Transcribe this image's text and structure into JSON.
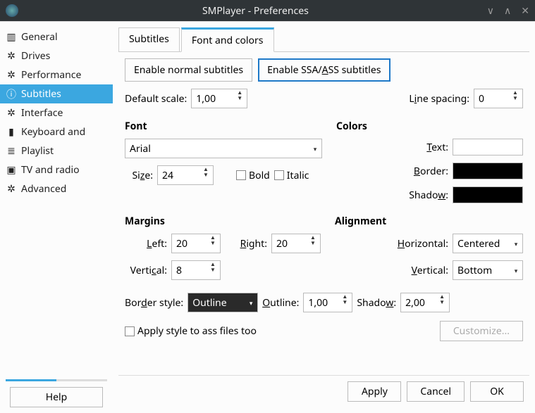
{
  "window": {
    "title": "SMPlayer - Preferences"
  },
  "sidebar": {
    "items": [
      {
        "label": "General",
        "icon": "sliders-icon"
      },
      {
        "label": "Drives",
        "icon": "gear-icon"
      },
      {
        "label": "Performance",
        "icon": "gear-icon"
      },
      {
        "label": "Subtitles",
        "icon": "info-icon"
      },
      {
        "label": "Interface",
        "icon": "gear-icon"
      },
      {
        "label": "Keyboard and",
        "icon": "keyboard-icon"
      },
      {
        "label": "Playlist",
        "icon": "list-icon"
      },
      {
        "label": "TV and radio",
        "icon": "tv-icon"
      },
      {
        "label": "Advanced",
        "icon": "gear-icon"
      }
    ]
  },
  "tabs": {
    "subtitles": "Subtitles",
    "fontcolors": "Font and colors"
  },
  "subtabs": {
    "normal": "Enable normal subtitles",
    "ssa_pre": "Enable SSA/",
    "ssa_u": "A",
    "ssa_post": "SS subtitles"
  },
  "labels": {
    "default_scale": "Default scale:",
    "line_spacing_pre": "L",
    "line_spacing_u": "i",
    "line_spacing_post": "ne spacing:",
    "font_group": "Font",
    "colors_group": "Colors",
    "size_pre": "Si",
    "size_u": "z",
    "size_post": "e:",
    "bold": "Bold",
    "italic": "Italic",
    "text_pre": "",
    "text_u": "T",
    "text_post": "ext:",
    "border_pre": "",
    "border_u": "B",
    "border_post": "order:",
    "shadow_pre": "Shado",
    "shadow_u": "w",
    "shadow_post": ":",
    "margins_group": "Margins",
    "alignment_group": "Alignment",
    "left_pre": "",
    "left_u": "L",
    "left_post": "eft:",
    "right_pre": "",
    "right_u": "R",
    "right_post": "ight:",
    "vertical1_pre": "Verti",
    "vertical1_u": "c",
    "vertical1_post": "al:",
    "horizontal_pre": "",
    "horizontal_u": "H",
    "horizontal_post": "orizontal:",
    "vertical2_pre": "",
    "vertical2_u": "V",
    "vertical2_post": "ertical:",
    "border_style_pre": "Bor",
    "border_style_u": "d",
    "border_style_post": "er style:",
    "outline_pre": "",
    "outline_u": "O",
    "outline_post": "utline:",
    "shadowv_pre": "Shado",
    "shadowv_u": "w",
    "shadowv_post": ":",
    "apply_ass": "Apply style to ass files too",
    "customize": "Customize..."
  },
  "values": {
    "default_scale": "1,00",
    "line_spacing": "0",
    "font": "Arial",
    "size": "24",
    "left": "20",
    "right": "20",
    "vmargin": "8",
    "halign": "Centered",
    "valign": "Bottom",
    "border_style": "Outline",
    "outline": "1,00",
    "shadow": "2,00"
  },
  "buttons": {
    "help": "Help",
    "apply": "Apply",
    "cancel": "Cancel",
    "ok": "OK"
  }
}
